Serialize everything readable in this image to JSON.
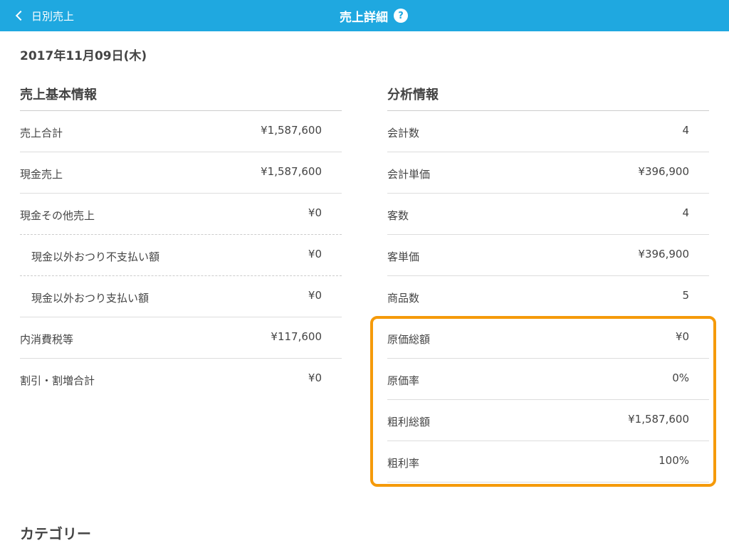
{
  "nav": {
    "back_label": "日別売上",
    "title": "売上詳細",
    "help_glyph": "?"
  },
  "date": "2017年11月09日(木)",
  "basic": {
    "title": "売上基本情報",
    "rows": [
      {
        "label": "売上合計",
        "value": "¥1,587,600"
      },
      {
        "label": "現金売上",
        "value": "¥1,587,600"
      },
      {
        "label": "現金その他売上",
        "value": "¥0"
      },
      {
        "label": "現金以外おつり不支払い額",
        "value": "¥0"
      },
      {
        "label": "現金以外おつり支払い額",
        "value": "¥0"
      },
      {
        "label": "内消費税等",
        "value": "¥117,600"
      },
      {
        "label": "割引・割増合計",
        "value": "¥0"
      }
    ]
  },
  "analysis": {
    "title": "分析情報",
    "rows": [
      {
        "label": "会計数",
        "value": "4"
      },
      {
        "label": "会計単価",
        "value": "¥396,900"
      },
      {
        "label": "客数",
        "value": "4"
      },
      {
        "label": "客単価",
        "value": "¥396,900"
      },
      {
        "label": "商品数",
        "value": "5"
      },
      {
        "label": "原価総額",
        "value": "¥0"
      },
      {
        "label": "原価率",
        "value": "0%"
      },
      {
        "label": "粗利総額",
        "value": "¥1,587,600"
      },
      {
        "label": "粗利率",
        "value": "100%"
      }
    ]
  },
  "category": {
    "title": "カテゴリー"
  },
  "colors": {
    "navbar": "#1fa8e0",
    "highlight": "#f59a0a"
  }
}
